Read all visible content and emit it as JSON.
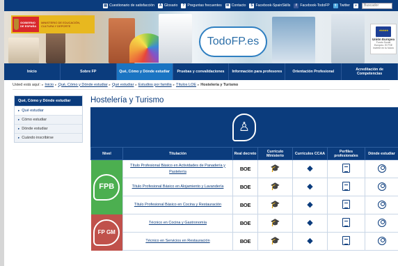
{
  "topbar": {
    "links": [
      {
        "label": "Cuestionario de satisfacción",
        "icon": "document-icon"
      },
      {
        "label": "Glosario",
        "icon": "glossary-icon"
      },
      {
        "label": "Preguntas frecuentes",
        "icon": "speech-bubble-icon"
      },
      {
        "label": "Contacto",
        "icon": "envelope-icon"
      },
      {
        "label": "Facebook-SpainSkills",
        "icon": "skills-icon"
      },
      {
        "label": "Facebook-TodoFP",
        "icon": "facebook-icon"
      },
      {
        "label": "Twitter",
        "icon": "twitter-icon"
      }
    ],
    "search_placeholder": "Buscador"
  },
  "banner": {
    "gov_left": "GOBIERNO DE ESPAÑA",
    "gov_right": "MINISTERIO DE EDUCACIÓN, CULTURA Y DEPORTE",
    "logo": "TodoFP.es",
    "eu_title": "Unión Europea",
    "eu_subtitle": "Fondo Social Europeo. El FSE invierte en tu futuro"
  },
  "nav": [
    {
      "label": "Inicio",
      "active": false
    },
    {
      "label": "Sobre FP",
      "active": false
    },
    {
      "label": "Qué, Cómo y Dónde estudiar",
      "active": true
    },
    {
      "label": "Pruebas y convalidaciones",
      "active": false
    },
    {
      "label": "Información para profesores",
      "active": false
    },
    {
      "label": "Orientación Profesional",
      "active": false
    },
    {
      "label": "Acreditación de Competencias",
      "active": false
    }
  ],
  "breadcrumb": {
    "prefix": "Usted está aquí:",
    "items": [
      "Inicio",
      "Qué, Cómo y Dónde estudiar",
      "Qué estudiar",
      "Estudios por familia",
      "Títulos LOE"
    ],
    "current": "Hostelería y Turismo"
  },
  "sidebar": {
    "title": "Qué, Cómo y Dónde estudiar",
    "items": [
      "Qué estudiar",
      "Cómo estudiar",
      "Dónde estudiar",
      "Cuándo inscribirse"
    ]
  },
  "page_title": "Hostelería y Turismo",
  "table": {
    "headers": [
      "Nivel",
      "Titulación",
      "Real decreto",
      "Currículo Ministerio",
      "Currículos CCAA",
      "Perfiles profesionales",
      "Dónde estudiar"
    ],
    "levels": [
      {
        "label": "FPB",
        "color": "#4caf50"
      },
      {
        "label": "FP GM",
        "color": "#c0514b"
      }
    ],
    "rows": [
      {
        "titulo": "Título Profesional Básico en Actividades de Panadería y Pastelería",
        "boe": "BOE"
      },
      {
        "titulo": "Título Profesional Básico en Alojamiento y Lavandería",
        "boe": "BOE"
      },
      {
        "titulo": "Título Profesional Básico en Cocina y Restauración",
        "boe": "BOE"
      },
      {
        "titulo": "Técnico en Cocina y Gastronomía",
        "boe": "BOE"
      },
      {
        "titulo": "Técnico en Servicios en Restauración",
        "boe": "BOE"
      }
    ]
  }
}
